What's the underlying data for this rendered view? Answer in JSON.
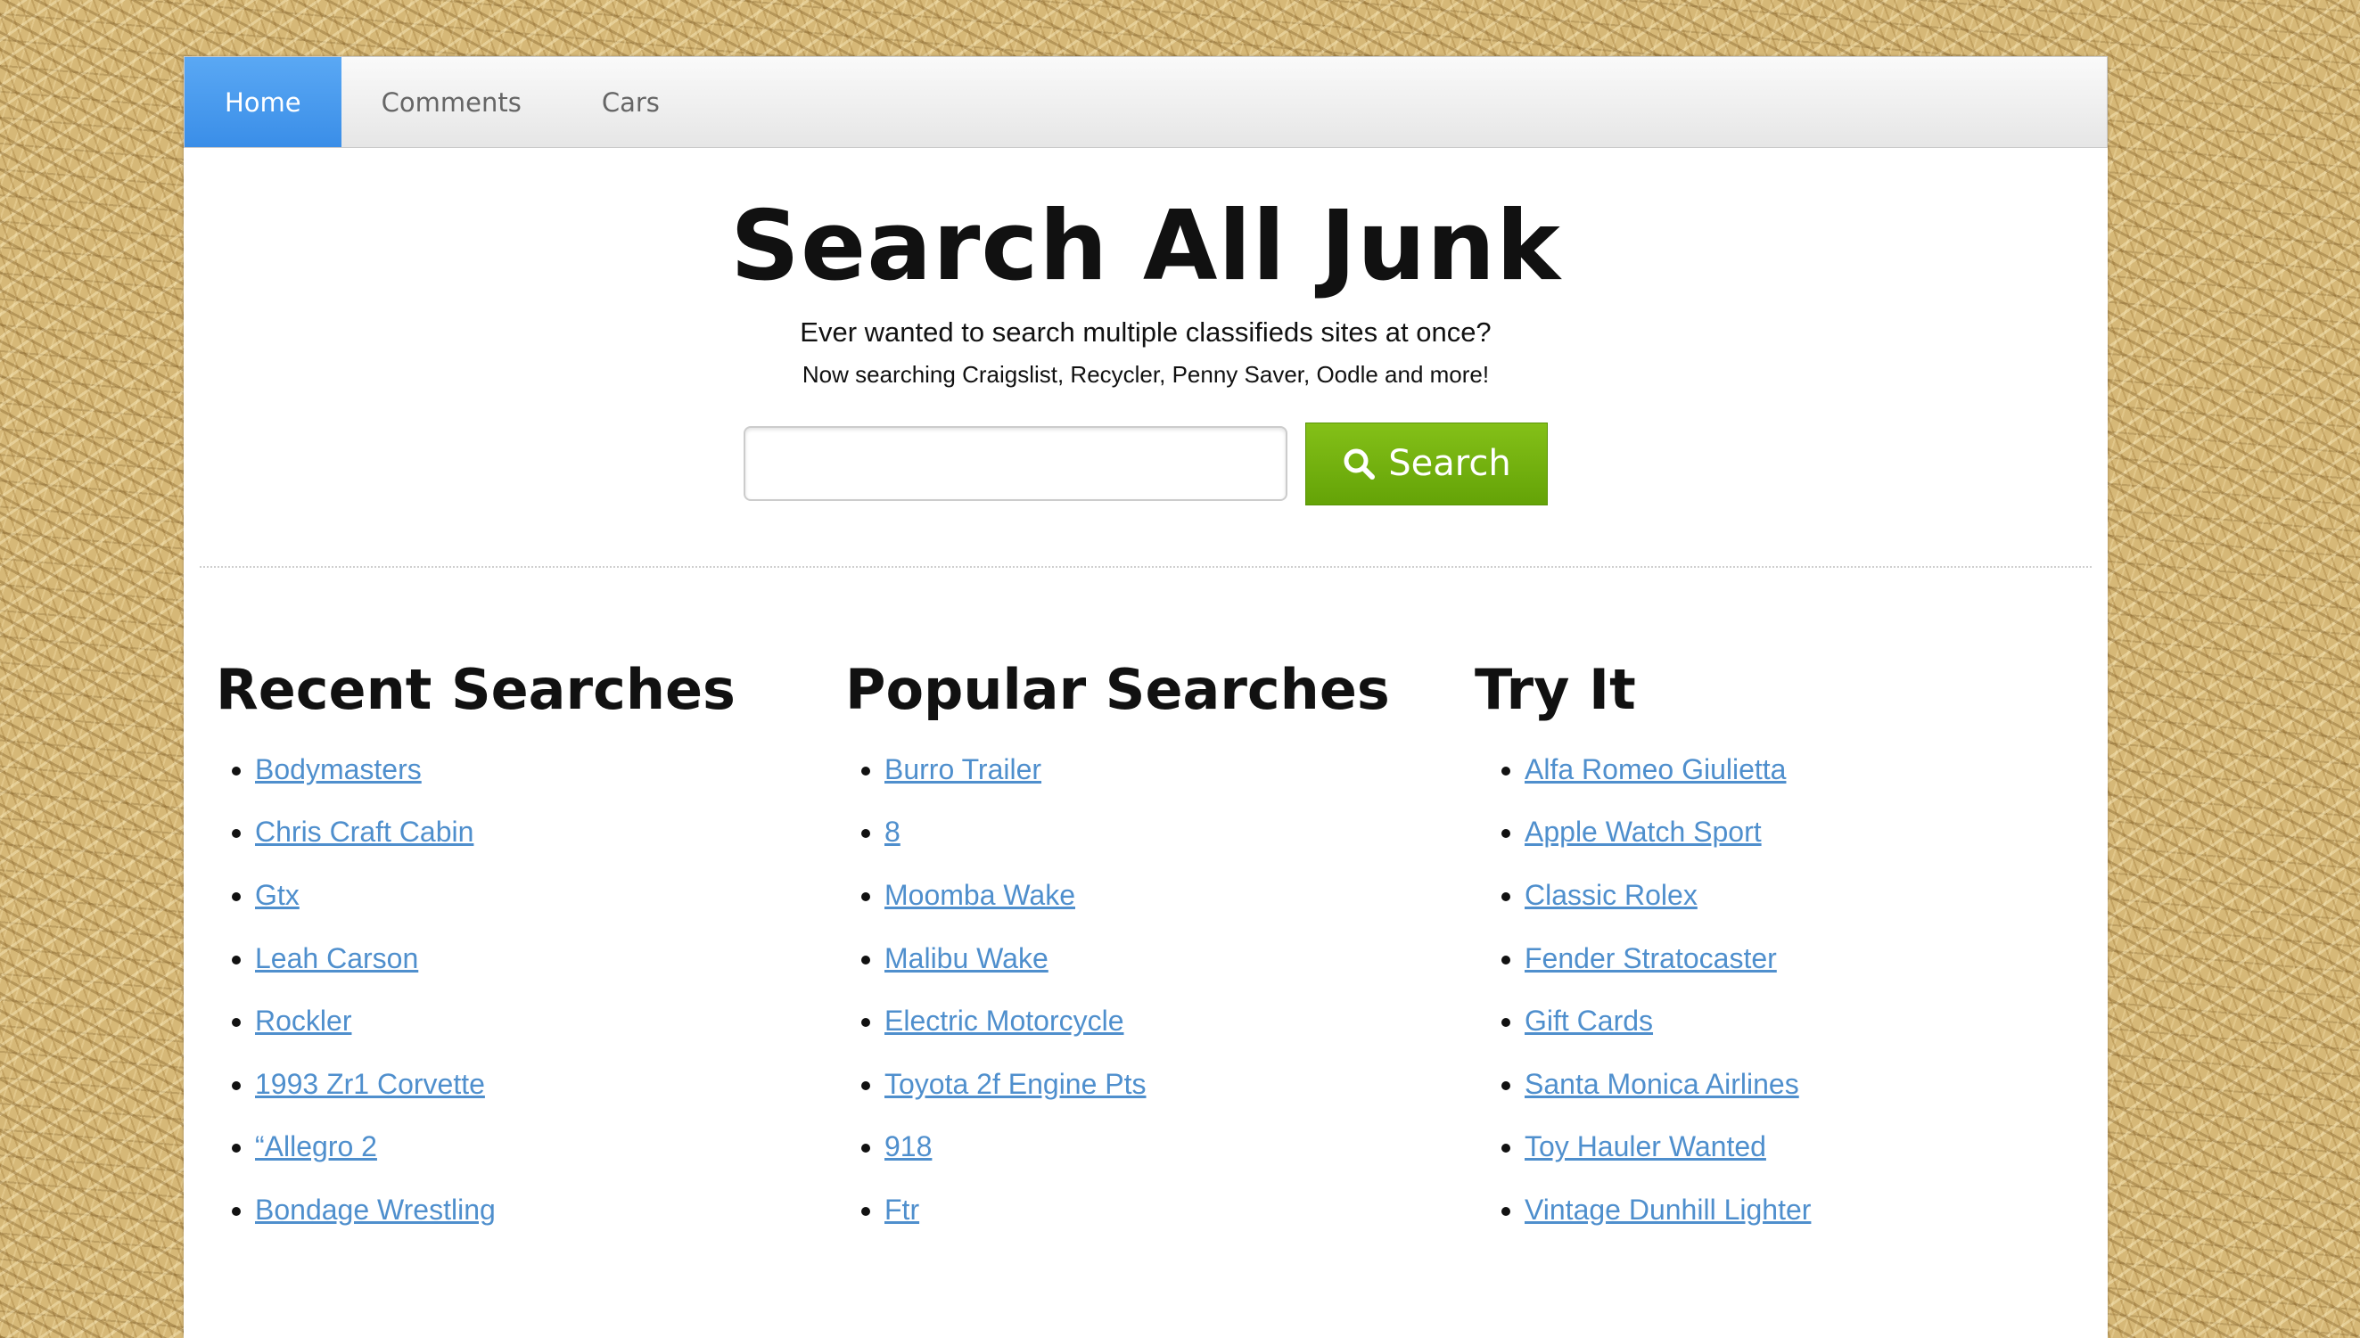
{
  "nav": {
    "items": [
      {
        "label": "Home",
        "active": true
      },
      {
        "label": "Comments",
        "active": false
      },
      {
        "label": "Cars",
        "active": false
      }
    ]
  },
  "hero": {
    "title": "Search All Junk",
    "tagline": "Ever wanted to search multiple classifieds sites at once?",
    "subline": "Now searching Craigslist, Recycler, Penny Saver, Oodle and more!"
  },
  "search": {
    "value": "",
    "button_label": "Search",
    "button_icon": "search-icon"
  },
  "colors": {
    "nav_active": "#4a9bef",
    "search_button": "#74b20f",
    "link": "#4f8fcd"
  },
  "recent": {
    "title": "Recent Searches",
    "items": [
      "Bodymasters",
      "Chris Craft Cabin",
      "Gtx",
      "Leah Carson",
      "Rockler",
      "1993 Zr1 Corvette",
      "“Allegro 2",
      "Bondage Wrestling"
    ]
  },
  "popular": {
    "title": "Popular Searches",
    "items": [
      "Burro Trailer",
      "8",
      "Moomba Wake",
      "Malibu Wake",
      "Electric Motorcycle",
      "Toyota 2f Engine Pts",
      "918",
      "Ftr"
    ]
  },
  "tryit": {
    "title": "Try It",
    "items": [
      "Alfa Romeo Giulietta",
      "Apple Watch Sport",
      "Classic Rolex",
      "Fender Stratocaster",
      "Gift Cards",
      "Santa Monica Airlines",
      "Toy Hauler Wanted",
      "Vintage Dunhill Lighter"
    ]
  }
}
